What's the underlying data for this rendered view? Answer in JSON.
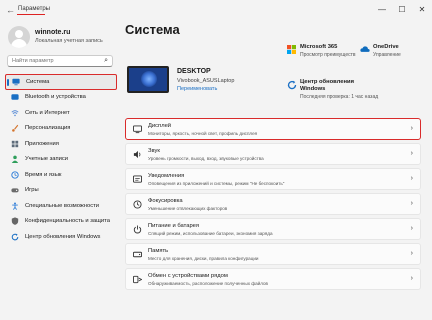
{
  "window": {
    "title": "Параметры",
    "back_glyph": "←",
    "minimize_glyph": "—",
    "maximize_glyph": "☐",
    "close_glyph": "✕"
  },
  "profile": {
    "name": "winnote.ru",
    "subtitle": "Локальная учетная запись"
  },
  "search": {
    "placeholder": "Найти параметр"
  },
  "sidebar": {
    "items": [
      {
        "label": "Система",
        "icon": "system-icon",
        "color": "#1a6fc4"
      },
      {
        "label": "Bluetooth и устройства",
        "icon": "bluetooth-icon",
        "color": "#1a6fc4"
      },
      {
        "label": "Сеть и Интернет",
        "icon": "network-icon",
        "color": "#5b8dd6"
      },
      {
        "label": "Персонализация",
        "icon": "brush-icon",
        "color": "#d4732b"
      },
      {
        "label": "Приложения",
        "icon": "apps-icon",
        "color": "#5d6b7a"
      },
      {
        "label": "Учетные записи",
        "icon": "accounts-icon",
        "color": "#2e9e5b"
      },
      {
        "label": "Время и язык",
        "icon": "time-language-icon",
        "color": "#2f7ed8"
      },
      {
        "label": "Игры",
        "icon": "games-icon",
        "color": "#6b6b6b"
      },
      {
        "label": "Специальные возможности",
        "icon": "accessibility-icon",
        "color": "#2f7ed8"
      },
      {
        "label": "Конфиденциальность и защита",
        "icon": "shield-icon",
        "color": "#666666"
      },
      {
        "label": "Центр обновления Windows",
        "icon": "update-icon",
        "color": "#1a6fc4"
      }
    ]
  },
  "main": {
    "title": "Система",
    "device": {
      "name": "DESKTOP",
      "model": "Vivobook_ASUSLaptop",
      "rename_label": "Переименовать"
    },
    "quick": {
      "m365": {
        "title": "Microsoft 365",
        "sub": "Просмотр преимуществ"
      },
      "onedrive": {
        "title": "OneDrive",
        "sub": "Управление"
      },
      "update": {
        "title": "Центр обновления Windows",
        "sub": "Последняя проверка: 1 час назад"
      }
    },
    "cards": [
      {
        "title": "Дисплей",
        "sub": "Мониторы, яркость, ночной свет, профиль дисплея",
        "icon": "display-icon"
      },
      {
        "title": "Звук",
        "sub": "Уровень громкости, выход, вход, звуковые устройства",
        "icon": "sound-icon"
      },
      {
        "title": "Уведомления",
        "sub": "Оповещения из приложений и системы, режим \"Не беспокоить\"",
        "icon": "notifications-icon"
      },
      {
        "title": "Фокусировка",
        "sub": "Уменьшение отвлекающих факторов",
        "icon": "focus-icon"
      },
      {
        "title": "Питание и батарея",
        "sub": "Спящий режим, использование батареи, экономия заряда",
        "icon": "power-icon"
      },
      {
        "title": "Память",
        "sub": "Место для хранения, диски, правила конфигурации",
        "icon": "storage-icon"
      },
      {
        "title": "Обмен с устройствами рядом",
        "sub": "Обнаруживаемость, расположение полученных файлов",
        "icon": "nearby-sharing-icon"
      }
    ],
    "chevron": "›"
  }
}
